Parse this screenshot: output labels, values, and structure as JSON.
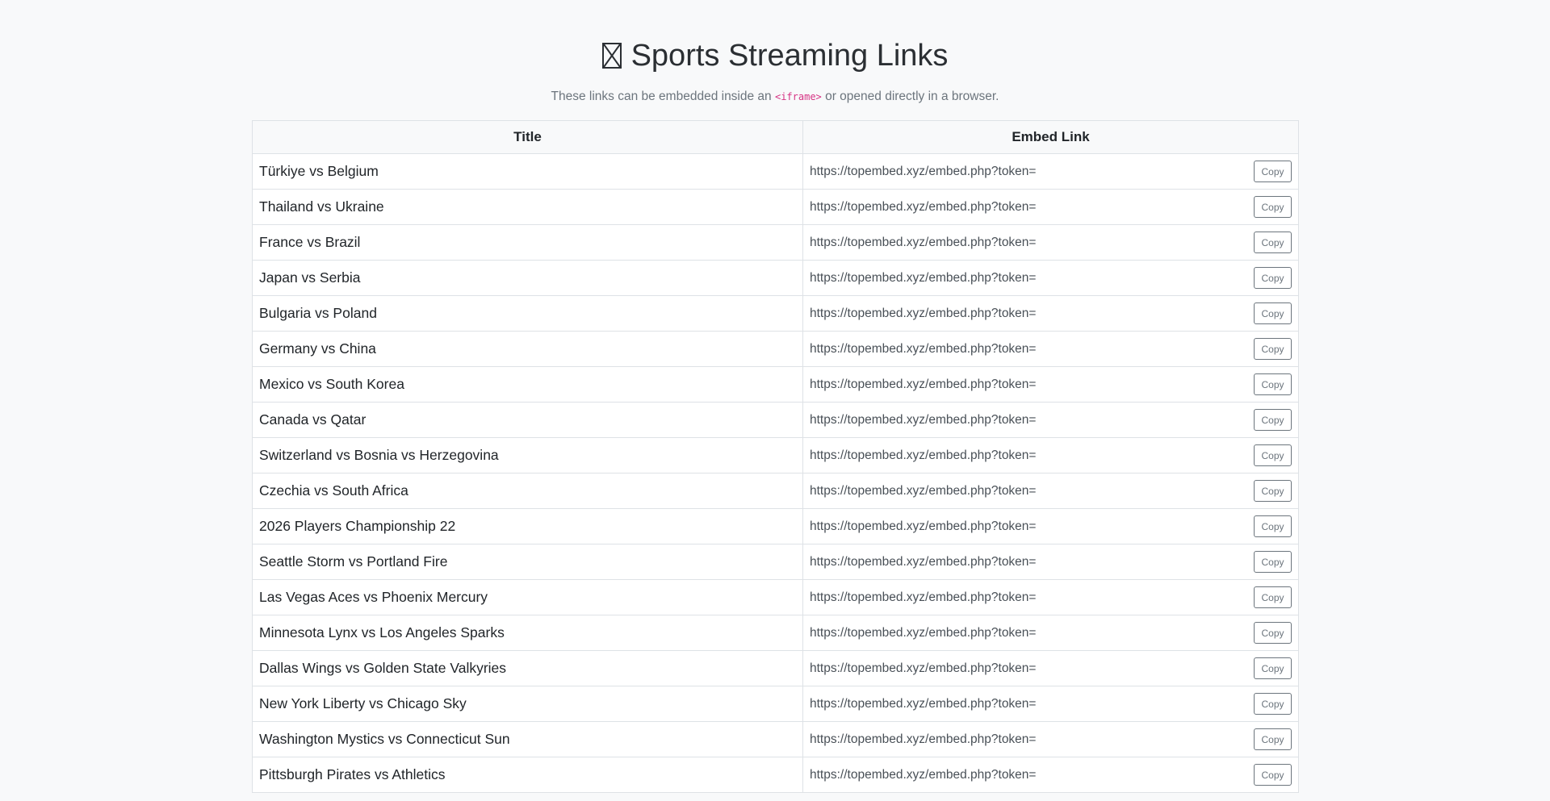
{
  "header": {
    "icon": "missing-glyph-icon",
    "title": "Sports Streaming Links",
    "subtitle_before": "These links can be embedded inside an ",
    "subtitle_code": "<iframe>",
    "subtitle_after": " or opened directly in a browser."
  },
  "table": {
    "headers": {
      "title": "Title",
      "link": "Embed Link"
    },
    "copy_label": "Copy",
    "rows": [
      {
        "title": "Türkiye vs Belgium",
        "link": "https://topembed.xyz/embed.php?token="
      },
      {
        "title": "Thailand vs Ukraine",
        "link": "https://topembed.xyz/embed.php?token="
      },
      {
        "title": "France vs Brazil",
        "link": "https://topembed.xyz/embed.php?token="
      },
      {
        "title": "Japan vs Serbia",
        "link": "https://topembed.xyz/embed.php?token="
      },
      {
        "title": "Bulgaria vs Poland",
        "link": "https://topembed.xyz/embed.php?token="
      },
      {
        "title": "Germany vs China",
        "link": "https://topembed.xyz/embed.php?token="
      },
      {
        "title": "Mexico vs South Korea",
        "link": "https://topembed.xyz/embed.php?token="
      },
      {
        "title": "Canada vs Qatar",
        "link": "https://topembed.xyz/embed.php?token="
      },
      {
        "title": "Switzerland vs Bosnia vs Herzegovina",
        "link": "https://topembed.xyz/embed.php?token="
      },
      {
        "title": "Czechia vs South Africa",
        "link": "https://topembed.xyz/embed.php?token="
      },
      {
        "title": "2026 Players Championship 22",
        "link": "https://topembed.xyz/embed.php?token="
      },
      {
        "title": "Seattle Storm vs Portland Fire",
        "link": "https://topembed.xyz/embed.php?token="
      },
      {
        "title": "Las Vegas Aces vs Phoenix Mercury",
        "link": "https://topembed.xyz/embed.php?token="
      },
      {
        "title": "Minnesota Lynx vs Los Angeles Sparks",
        "link": "https://topembed.xyz/embed.php?token="
      },
      {
        "title": "Dallas Wings vs Golden State Valkyries",
        "link": "https://topembed.xyz/embed.php?token="
      },
      {
        "title": "New York Liberty vs Chicago Sky",
        "link": "https://topembed.xyz/embed.php?token="
      },
      {
        "title": "Washington Mystics vs Connecticut Sun",
        "link": "https://topembed.xyz/embed.php?token="
      },
      {
        "title": "Pittsburgh Pirates vs Athletics",
        "link": "https://topembed.xyz/embed.php?token="
      }
    ]
  }
}
